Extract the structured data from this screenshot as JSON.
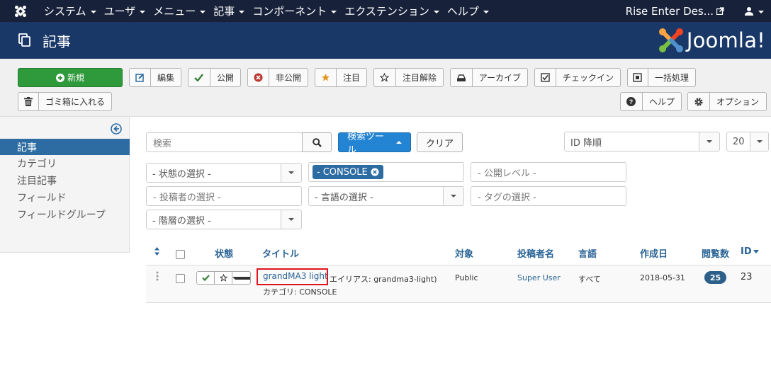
{
  "navbar": {
    "menu": [
      "システム",
      "ユーザ",
      "メニュー",
      "記事",
      "コンポーネント",
      "エクステンション",
      "ヘルプ"
    ],
    "site_label": "Rise Enter Des...",
    "logo_icon": "joomla-logo-icon",
    "user_icon": "user-icon"
  },
  "header": {
    "title": "記事",
    "brand": "Joomla!"
  },
  "toolbar": {
    "new": "新規",
    "edit": "編集",
    "publish": "公開",
    "unpublish": "非公開",
    "feature": "注目",
    "unfeature": "注目解除",
    "archive": "アーカイブ",
    "checkin": "チェックイン",
    "batch": "一括処理",
    "trash": "ゴミ箱に入れる",
    "help": "ヘルプ",
    "options": "オプション"
  },
  "sidebar": {
    "items": [
      "記事",
      "カテゴリ",
      "注目記事",
      "フィールド",
      "フィールドグループ"
    ],
    "active_index": 0
  },
  "filters": {
    "search_placeholder": "検索",
    "search_tools": "検索ツール",
    "clear": "クリア",
    "sort": "ID 降順",
    "limit": "20",
    "status": "- 状態の選択 -",
    "category_chip": "CONSOLE",
    "access": "- 公開レベル -",
    "author": "- 投稿者の選択 -",
    "language": "- 言語の選択 -",
    "tag": "- タグの選択 -",
    "level": "- 階層の選択 -"
  },
  "table": {
    "headers": {
      "status": "状態",
      "title": "タイトル",
      "access": "対象",
      "author": "投稿者名",
      "language": "言語",
      "created": "作成日",
      "hits": "閲覧数",
      "id": "ID"
    },
    "rows": [
      {
        "title": "grandMA3 light",
        "alias": "エイリアス: grandma3-light)",
        "category": "カテゴリ: CONSOLE",
        "access": "Public",
        "author": "Super User",
        "language": "すべて",
        "created": "2018-05-31",
        "hits": "25",
        "id": "23"
      }
    ]
  },
  "colors": {
    "navbar": "#17223a",
    "header": "#1a3867",
    "new_button": "#2f9a3c",
    "search_tools": "#2384d3",
    "active_sidebar": "#2d6ca2",
    "highlight": "#e0141e"
  }
}
